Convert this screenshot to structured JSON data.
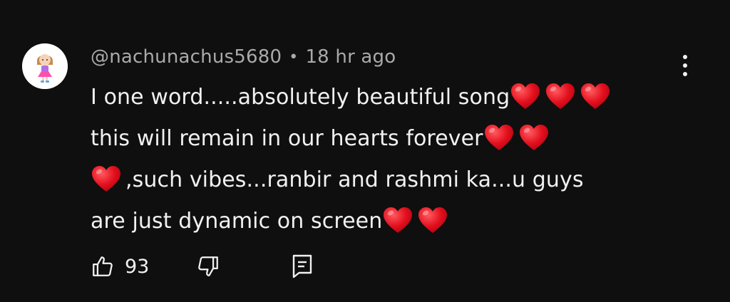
{
  "comment": {
    "author": "@nachunachus5680",
    "separator": "•",
    "timestamp": "18 hr ago",
    "lines": [
      {
        "text": "I one word.....absolutely beautiful song",
        "hearts_after": 3
      },
      {
        "text": "this will remain in our hearts forever",
        "hearts_after": 2
      },
      {
        "hearts_before": 1,
        "text": ",such vibes...ranbir and rashmi ka...u guys"
      },
      {
        "text": "are just dynamic on screen",
        "hearts_after": 2
      }
    ],
    "emoji": "red-heart",
    "like_count": "93"
  },
  "icons": {
    "avatar": "cartoon-girl-avatar",
    "menu": "more-vertical-icon",
    "like": "thumbs-up-icon",
    "dislike": "thumbs-down-icon",
    "reply": "comment-reply-icon"
  },
  "colors": {
    "background": "#0f0f0f",
    "text": "#f1f1f1",
    "secondary_text": "#aaaaaa",
    "heart": "#e3101e"
  }
}
